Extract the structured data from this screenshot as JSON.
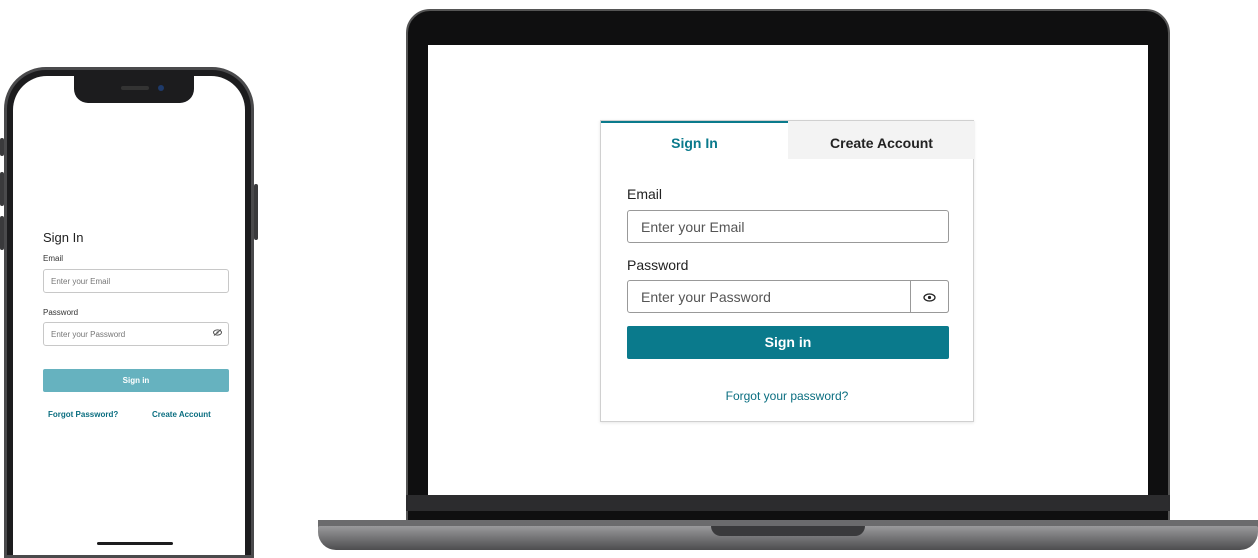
{
  "phone": {
    "title": "Sign In",
    "email_label": "Email",
    "email_placeholder": "Enter your Email",
    "password_label": "Password",
    "password_placeholder": "Enter your Password",
    "eye_icon": "eye-slash-icon",
    "signin_label": "Sign in",
    "forgot_label": "Forgot Password?",
    "create_label": "Create Account"
  },
  "desktop": {
    "tabs": [
      {
        "label": "Sign In",
        "active": true
      },
      {
        "label": "Create Account",
        "active": false
      }
    ],
    "email_label": "Email",
    "email_placeholder": "Enter your Email",
    "password_label": "Password",
    "password_placeholder": "Enter your Password",
    "eye_icon": "eye-icon",
    "signin_label": "Sign in",
    "forgot_label": "Forgot your password?"
  },
  "colors": {
    "accent": "#0a7a8c",
    "accent_disabled": "#66b2bf",
    "tab_inactive_bg": "#f3f3f3"
  }
}
